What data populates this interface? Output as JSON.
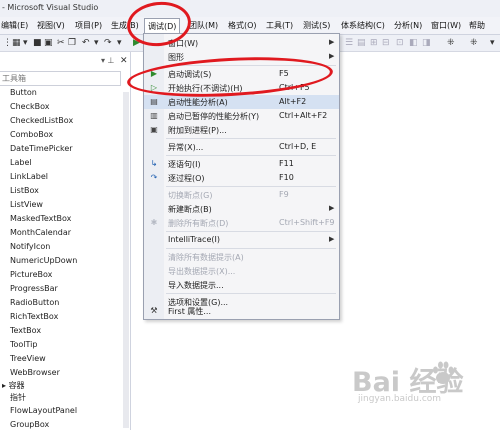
{
  "window": {
    "title": "- Microsoft Visual Studio"
  },
  "menubar": {
    "items": [
      "编辑(E)",
      "视图(V)",
      "项目(P)",
      "生成(B)",
      "调试(D)",
      "团队(M)",
      "格式(O)",
      "工具(T)",
      "测试(S)",
      "体系结构(C)",
      "分析(N)",
      "窗口(W)",
      "帮助"
    ]
  },
  "toolbox": {
    "title": "工具箱",
    "items": [
      "Button",
      "CheckBox",
      "CheckedListBox",
      "ComboBox",
      "DateTimePicker",
      "Label",
      "LinkLabel",
      "ListBox",
      "ListView",
      "MaskedTextBox",
      "MonthCalendar",
      "NotifyIcon",
      "NumericUpDown",
      "PictureBox",
      "ProgressBar",
      "RadioButton",
      "RichTextBox",
      "TextBox",
      "ToolTip",
      "TreeView",
      "WebBrowser"
    ],
    "section": "容器",
    "section_prefix": "▸",
    "section_items": [
      "指针",
      "FlowLayoutPanel",
      "GroupBox"
    ]
  },
  "debug_menu": {
    "items": [
      {
        "label": "窗口(W)",
        "shortcut": "",
        "submenu": true,
        "icon": "",
        "disabled": false
      },
      {
        "label": "图形",
        "shortcut": "",
        "submenu": true,
        "icon": "",
        "disabled": false
      },
      {
        "label": "启动调试(S)",
        "shortcut": "F5",
        "submenu": false,
        "icon": "play-icon",
        "disabled": false
      },
      {
        "label": "开始执行(不调试)(H)",
        "shortcut": "Ctrl+F5",
        "submenu": false,
        "icon": "play-outline-icon",
        "disabled": false
      },
      {
        "label": "启动性能分析(A)",
        "shortcut": "Alt+F2",
        "submenu": false,
        "icon": "performance-icon",
        "disabled": false
      },
      {
        "label": "启动已暂停的性能分析(Y)",
        "shortcut": "Ctrl+Alt+F2",
        "submenu": false,
        "icon": "paused-performance-icon",
        "disabled": false
      },
      {
        "label": "附加到进程(P)...",
        "shortcut": "",
        "submenu": false,
        "icon": "attach-icon",
        "disabled": false
      },
      {
        "label": "异常(X)...",
        "shortcut": "Ctrl+D, E",
        "submenu": false,
        "icon": "",
        "disabled": false
      },
      {
        "label": "逐语句(I)",
        "shortcut": "F11",
        "submenu": false,
        "icon": "step-into-icon",
        "disabled": false
      },
      {
        "label": "逐过程(O)",
        "shortcut": "F10",
        "submenu": false,
        "icon": "step-over-icon",
        "disabled": false
      },
      {
        "label": "切换断点(G)",
        "shortcut": "F9",
        "submenu": false,
        "icon": "",
        "disabled": true
      },
      {
        "label": "新建断点(B)",
        "shortcut": "",
        "submenu": true,
        "icon": "",
        "disabled": false
      },
      {
        "label": "删除所有断点(D)",
        "shortcut": "Ctrl+Shift+F9",
        "submenu": false,
        "icon": "delete-breakpoints-icon",
        "disabled": true
      },
      {
        "label": "IntelliTrace(I)",
        "shortcut": "",
        "submenu": true,
        "icon": "",
        "disabled": false
      },
      {
        "label": "清除所有数据提示(A)",
        "shortcut": "",
        "submenu": false,
        "icon": "",
        "disabled": true
      },
      {
        "label": "导出数据提示(X)...",
        "shortcut": "",
        "submenu": false,
        "icon": "",
        "disabled": true
      },
      {
        "label": "导入数据提示...",
        "shortcut": "",
        "submenu": false,
        "icon": "",
        "disabled": false
      },
      {
        "label": "选项和设置(G)...",
        "shortcut": "",
        "submenu": false,
        "icon": "",
        "disabled": false
      },
      {
        "label": "First 属性...",
        "shortcut": "",
        "submenu": false,
        "icon": "wrench-icon",
        "disabled": false
      }
    ]
  },
  "watermark": {
    "brand": "Bai 经验",
    "url": "jingyan.baidu.com"
  },
  "colors": {
    "accent": "#e0191f",
    "menu_bg": "#f5f5f7",
    "highlight": "#d5e1f2"
  }
}
